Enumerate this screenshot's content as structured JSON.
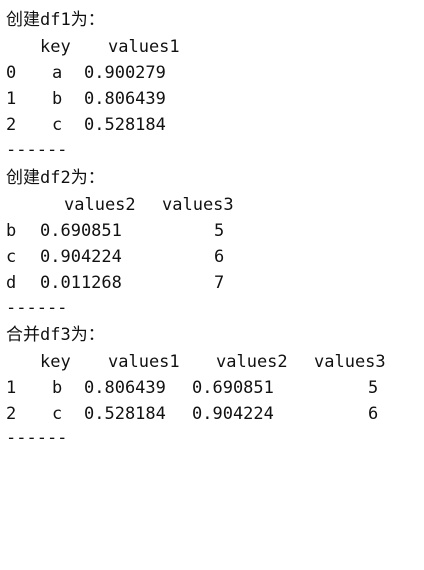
{
  "output": {
    "df1": {
      "heading": "创建df1为：",
      "columns": [
        "key",
        "values1"
      ],
      "rows": [
        {
          "index": "0",
          "key": "a",
          "values1": "0.900279"
        },
        {
          "index": "1",
          "key": "b",
          "values1": "0.806439"
        },
        {
          "index": "2",
          "key": "c",
          "values1": "0.528184"
        }
      ],
      "separator": "------"
    },
    "df2": {
      "heading": "创建df2为：",
      "columns": [
        "values2",
        "values3"
      ],
      "rows": [
        {
          "index": "b",
          "values2": "0.690851",
          "values3": "5"
        },
        {
          "index": "c",
          "values2": "0.904224",
          "values3": "6"
        },
        {
          "index": "d",
          "values2": "0.011268",
          "values3": "7"
        }
      ],
      "separator": "------"
    },
    "df3": {
      "heading": "合并df3为：",
      "columns": [
        "key",
        "values1",
        "values2",
        "values3"
      ],
      "rows": [
        {
          "index": "1",
          "key": "b",
          "values1": "0.806439",
          "values2": "0.690851",
          "values3": "5"
        },
        {
          "index": "2",
          "key": "c",
          "values1": "0.528184",
          "values2": "0.904224",
          "values3": "6"
        }
      ],
      "separator": "------"
    }
  }
}
